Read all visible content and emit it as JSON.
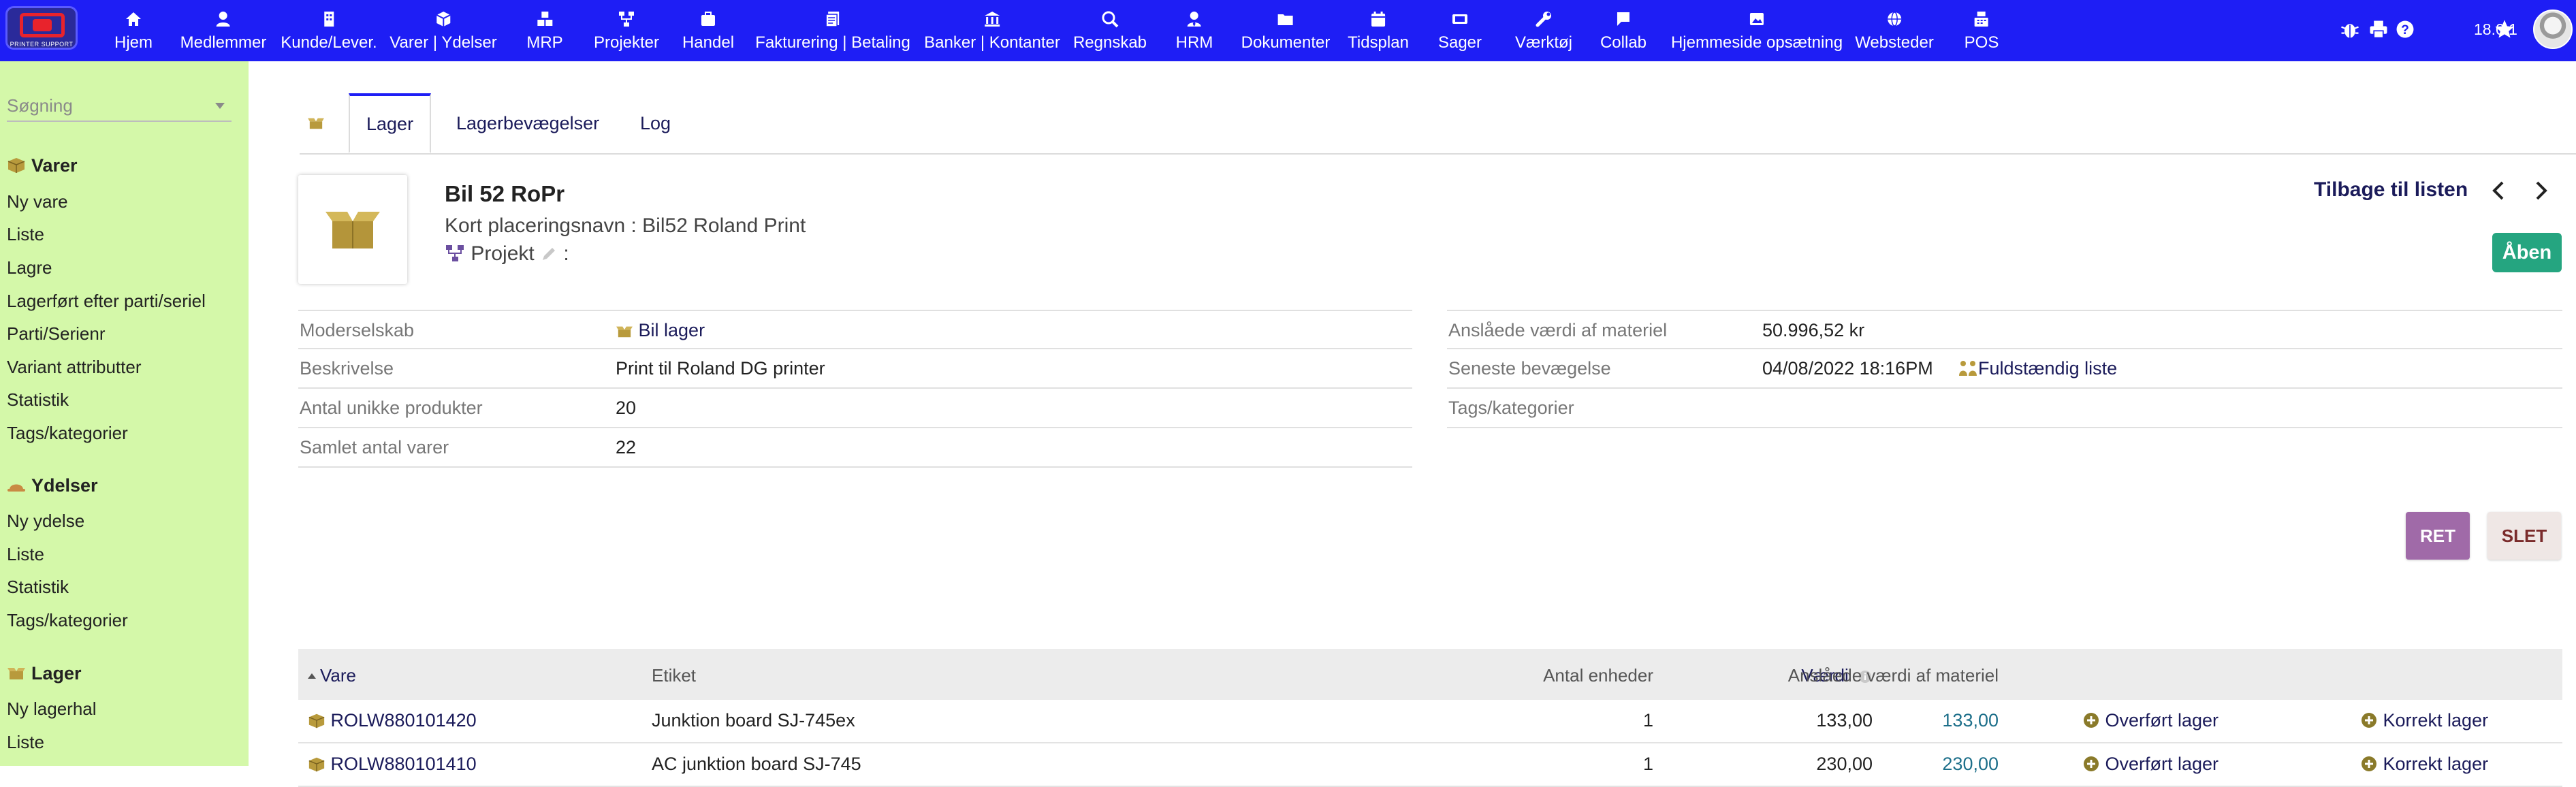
{
  "app": {
    "logo_text": "PRINTER SUPPORT",
    "version": "18.0.1",
    "brand_color": "#1e1ef5"
  },
  "menu": [
    {
      "label": "Hjem",
      "icon": "home-icon"
    },
    {
      "label": "Medlemmer",
      "icon": "user-icon"
    },
    {
      "label": "Kunde/Lever.",
      "icon": "building-icon"
    },
    {
      "label": "Varer | Ydelser",
      "icon": "cube-icon"
    },
    {
      "label": "MRP",
      "icon": "cubes-icon"
    },
    {
      "label": "Projekter",
      "icon": "sitemap-icon"
    },
    {
      "label": "Handel",
      "icon": "briefcase-icon"
    },
    {
      "label": "Fakturering | Betaling",
      "icon": "invoice-icon"
    },
    {
      "label": "Banker | Kontanter",
      "icon": "bank-icon"
    },
    {
      "label": "Regnskab",
      "icon": "search-dollar-icon"
    },
    {
      "label": "HRM",
      "icon": "user-tie-icon"
    },
    {
      "label": "Dokumenter",
      "icon": "folder-icon"
    },
    {
      "label": "Tidsplan",
      "icon": "calendar-icon"
    },
    {
      "label": "Sager",
      "icon": "ticket-icon"
    },
    {
      "label": "Værktøj",
      "icon": "wrench-icon"
    },
    {
      "label": "Collab",
      "icon": "comment-icon"
    },
    {
      "label": "Hjemmeside opsætning",
      "icon": "image-icon"
    },
    {
      "label": "Websteder",
      "icon": "globe-icon"
    },
    {
      "label": "POS",
      "icon": "cash-register-icon"
    }
  ],
  "sidebar": {
    "search_placeholder": "Søgning",
    "sections": [
      {
        "title": "Varer",
        "icon": "cube-icon",
        "items": [
          "Ny vare",
          "Liste",
          "Lagre",
          "Lagerført efter parti/seriel",
          "Parti/Serienr",
          "Variant attributter",
          "Statistik",
          "Tags/kategorier"
        ]
      },
      {
        "title": "Ydelser",
        "icon": "hat-icon",
        "items": [
          "Ny ydelse",
          "Liste",
          "Statistik",
          "Tags/kategorier"
        ]
      },
      {
        "title": "Lager",
        "icon": "box-open-icon",
        "items": [
          "Ny lagerhal",
          "Liste"
        ]
      }
    ]
  },
  "tabs": [
    "Lager",
    "Lagerbevægelser",
    "Log"
  ],
  "object": {
    "title": "Bil 52 RoPr",
    "alias_label": "Kort placeringsnavn :",
    "alias_value": "Bil52 Roland Print",
    "project_label": "Projekt",
    "project_suffix": ":",
    "back_label": "Tilbage til listen",
    "status": "Åben"
  },
  "fields_left": [
    {
      "label": "Moderselskab",
      "value": "Bil lager"
    },
    {
      "label": "Beskrivelse",
      "value": "Print til Roland DG printer"
    },
    {
      "label": "Antal unikke produkter",
      "value": "20"
    },
    {
      "label": "Samlet antal varer",
      "value": "22"
    }
  ],
  "fields_right": [
    {
      "label": "Anslåede værdi af materiel",
      "value": "50.996,52 kr"
    },
    {
      "label": "Seneste bevægelse",
      "value": "04/08/2022 18:16PM",
      "link": "Fuldstændig liste"
    },
    {
      "label": "Tags/kategorier",
      "value": ""
    }
  ],
  "actions": {
    "edit": "RET",
    "delete": "SLET"
  },
  "table": {
    "headers": [
      "Vare",
      "Etiket",
      "Antal enheder",
      "Værdi",
      "Anslåede værdi af materiel"
    ],
    "rows": [
      {
        "ref": "ROLW880101420",
        "label": "Junktion board SJ-745ex",
        "qty": "1",
        "value": "133,00",
        "est": "133,00",
        "action1": "Overført lager",
        "action2": "Korrekt lager"
      },
      {
        "ref": "ROLW880101410",
        "label": "AC junktion board SJ-745",
        "qty": "1",
        "value": "230,00",
        "est": "230,00",
        "action1": "Overført lager",
        "action2": "Korrekt lager"
      }
    ]
  }
}
